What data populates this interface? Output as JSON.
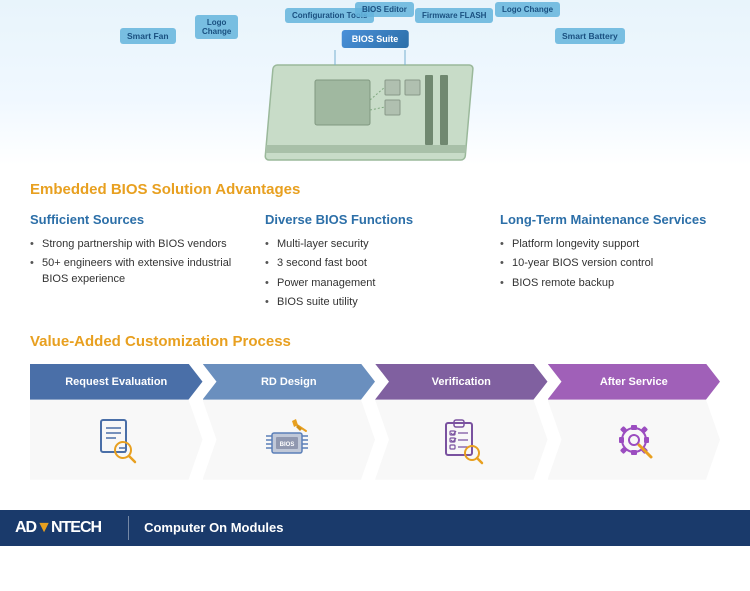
{
  "diagram": {
    "labels": {
      "smart_fan": "Smart Fan",
      "logo_change_left": "Logo\nChange",
      "config_tools": "Configuration Tools",
      "bios_editor": "BIOS Editor",
      "firmware_flash": "Firmware FLASH",
      "logo_change_right": "Logo Change",
      "smart_battery": "Smart Battery",
      "bios_suite": "BIOS Suite"
    }
  },
  "section1": {
    "title": "Embedded BIOS Solution Advantages",
    "col1": {
      "title": "Sufficient Sources",
      "items": [
        "Strong partnership with BIOS vendors",
        "50+ engineers with extensive industrial BIOS experience"
      ]
    },
    "col2": {
      "title": "Diverse BIOS Functions",
      "items": [
        "Multi-layer security",
        "3 second fast boot",
        "Power management",
        "BIOS suite utility"
      ]
    },
    "col3": {
      "title": "Long-Term Maintenance Services",
      "items": [
        "Platform longevity support",
        "10-year BIOS version control",
        "BIOS remote backup"
      ]
    }
  },
  "section2": {
    "title": "Value-Added Customization Process",
    "steps": [
      {
        "id": "step1",
        "label": "Request Evaluation",
        "color": "#3d5c96"
      },
      {
        "id": "step2",
        "label": "RD Design",
        "color": "#5b7fb8"
      },
      {
        "id": "step3",
        "label": "Verification",
        "color": "#7a52a0"
      },
      {
        "id": "step4",
        "label": "After Service",
        "color": "#9b4dc0"
      }
    ]
  },
  "footer": {
    "brand": "AD▼NTECH",
    "brand_adv": "AD",
    "brand_van": "▼",
    "brand_tech": "NTECH",
    "divider": "|",
    "product_line": "Computer On Modules"
  }
}
